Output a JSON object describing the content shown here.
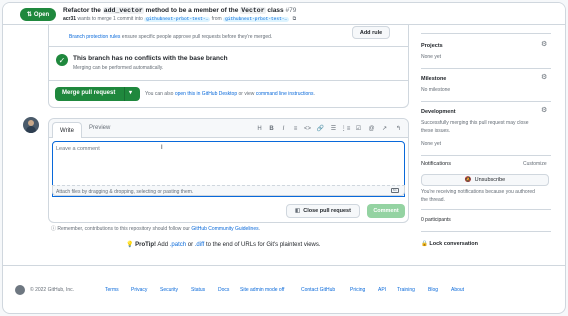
{
  "header": {
    "status_label": "Open",
    "title_pre": "Refactor the ",
    "title_code1": "add_vector",
    "title_mid": " method to be a member of the ",
    "title_code2": "Vector",
    "title_post": " class ",
    "number": "#79",
    "author": "acr31",
    "sub_mid": " wants to merge 1 commit into ",
    "base_branch": "githubnext-prbot-test-…",
    "sub_from": " from ",
    "head_branch": "githubnext-prbot-test-…"
  },
  "merge_box": {
    "protection_link": "Branch protection rules",
    "protection_text": " ensure specific people approve pull requests before they're merged.",
    "add_rule_label": "Add rule",
    "conflicts_title": "This branch has no conflicts with the base branch",
    "conflicts_sub": "Merging can be performed automatically.",
    "merge_button_label": "Merge pull request",
    "also_pre": "You can also ",
    "desktop_link": "open this in GitHub Desktop",
    "also_mid": " or view ",
    "cli_link": "command line instructions",
    "also_post": "."
  },
  "comment": {
    "tab_write": "Write",
    "tab_preview": "Preview",
    "toolbar": [
      "H",
      "B",
      "I",
      "≡",
      "<>",
      "🔗",
      "☰",
      "⋮≡",
      "☑",
      "@",
      "↗",
      "↰"
    ],
    "placeholder": "Leave a comment",
    "attach_text": "Attach files by dragging & dropping, selecting or pasting them.",
    "close_label": "Close pull request",
    "comment_label": "Comment"
  },
  "remember": {
    "pre": "Remember, contributions to this repository should follow our ",
    "link": "GitHub Community Guidelines",
    "post": "."
  },
  "protip": {
    "bold": "ProTip!",
    "pre": " Add ",
    "patch": ".patch",
    "or": " or ",
    "diff": ".diff",
    "post": " to the end of URLs for Git's plaintext views."
  },
  "sidebar": {
    "projects_label": "Projects",
    "projects_value": "None yet",
    "milestone_label": "Milestone",
    "milestone_value": "No milestone",
    "development_label": "Development",
    "development_text1": "Successfully merging this pull request may close",
    "development_text2": "these issues.",
    "development_value": "None yet",
    "notifications_label": "Notifications",
    "customize_label": "Customize",
    "unsubscribe_label": "Unsubscribe",
    "reason_1": "You're receiving notifications because you authored",
    "reason_2": "the thread.",
    "participants": "0 participants",
    "lock_label": "Lock conversation"
  },
  "footer": {
    "copyright": "© 2022 GitHub, Inc.",
    "links": [
      "Terms",
      "Privacy",
      "Security",
      "Status",
      "Docs",
      "Site admin mode off",
      "Contact GitHub",
      "Pricing",
      "API",
      "Training",
      "Blog",
      "About"
    ]
  },
  "colors": {
    "accent": "#0969da",
    "success": "#1f883d",
    "border": "#d0d7de"
  }
}
